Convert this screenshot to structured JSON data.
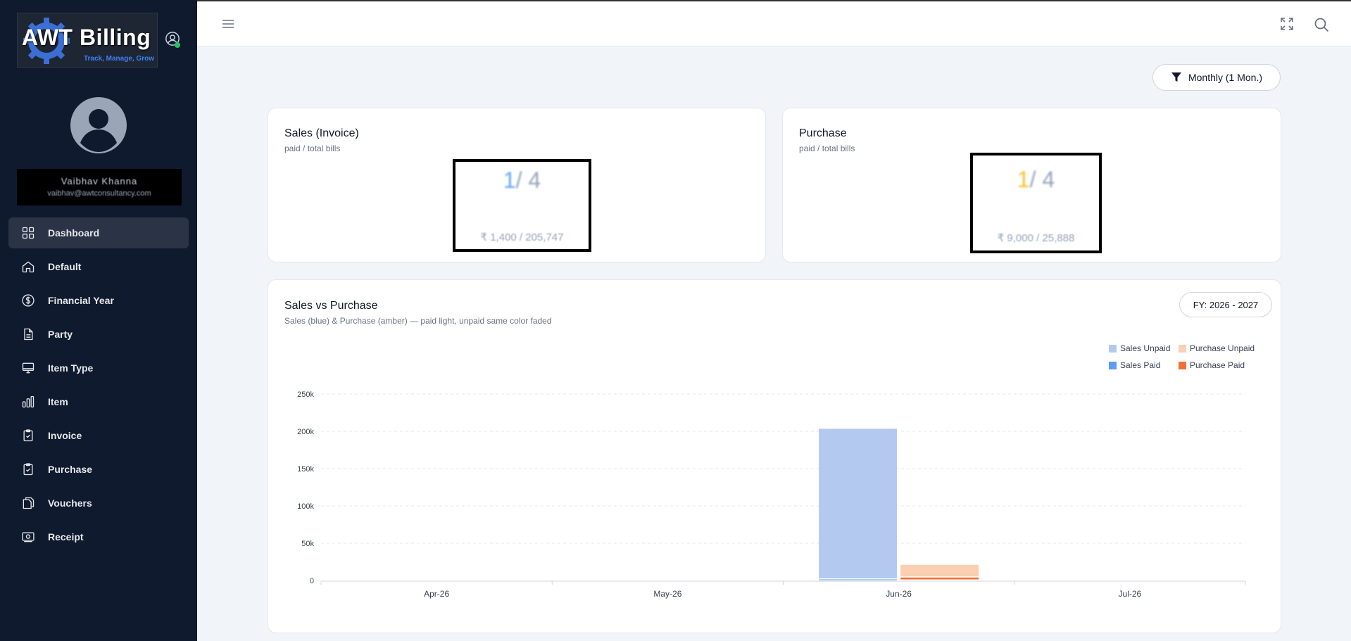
{
  "app": {
    "logo_text": "AWT Billing",
    "logo_tagline": "Track, Manage, Grow",
    "user_name": "Vaibhav Khanna",
    "user_email": "vaibhav@awtconsultancy.com"
  },
  "sidebar": {
    "items": [
      {
        "label": "Dashboard",
        "icon": "grid-icon",
        "active": true
      },
      {
        "label": "Default",
        "icon": "home-icon"
      },
      {
        "label": "Financial Year",
        "icon": "dollar-circle-icon"
      },
      {
        "label": "Party",
        "icon": "document-icon"
      },
      {
        "label": "Item Type",
        "icon": "monitor-icon"
      },
      {
        "label": "Item",
        "icon": "bar-chart-icon"
      },
      {
        "label": "Invoice",
        "icon": "clipboard-check-icon"
      },
      {
        "label": "Purchase",
        "icon": "clipboard-check-icon"
      },
      {
        "label": "Vouchers",
        "icon": "copy-icon"
      },
      {
        "label": "Receipt",
        "icon": "cash-icon"
      }
    ]
  },
  "filter": {
    "label": "Monthly (1 Mon.)"
  },
  "sales_card": {
    "title": "Sales (Invoice)",
    "subtitle": "paid / total bills",
    "paid_count": "1",
    "total_count": "/ 4",
    "amounts": "₹ 1,400 / 205,747"
  },
  "purchase_card": {
    "title": "Purchase",
    "subtitle": "paid / total bills",
    "paid_count": "1",
    "total_count": "/ 4",
    "amounts": "₹ 9,000 / 25,888"
  },
  "chart_card": {
    "title": "Sales vs Purchase",
    "subtitle": "Sales (blue) & Purchase (amber) — paid light, unpaid same color faded",
    "fy_label": "FY: 2026 - 2027"
  },
  "colors": {
    "sales_unpaid": "#b3c9ef",
    "sales_paid": "#5b9cf6",
    "purchase_unpaid": "#fbcfb1",
    "purchase_paid": "#f07136"
  },
  "chart_data": {
    "type": "bar",
    "categories": [
      "Apr-26",
      "May-26",
      "Jun-26",
      "Jul-26"
    ],
    "series": [
      {
        "name": "Sales Unpaid",
        "values": [
          0,
          0,
          202000,
          0
        ],
        "stack": "sales",
        "colorKey": "sales_unpaid"
      },
      {
        "name": "Sales Paid",
        "values": [
          0,
          0,
          1400,
          0
        ],
        "stack": "sales",
        "colorKey": "sales_paid"
      },
      {
        "name": "Purchase Unpaid",
        "values": [
          0,
          0,
          17000,
          0
        ],
        "stack": "purchase",
        "colorKey": "purchase_unpaid"
      },
      {
        "name": "Purchase Paid",
        "values": [
          0,
          0,
          4000,
          0
        ],
        "stack": "purchase",
        "colorKey": "purchase_paid"
      }
    ],
    "yticks": [
      "0",
      "50k",
      "100k",
      "150k",
      "200k",
      "250k"
    ],
    "ylim": [
      0,
      250000
    ],
    "grid": true,
    "legend_position": "top-right"
  }
}
